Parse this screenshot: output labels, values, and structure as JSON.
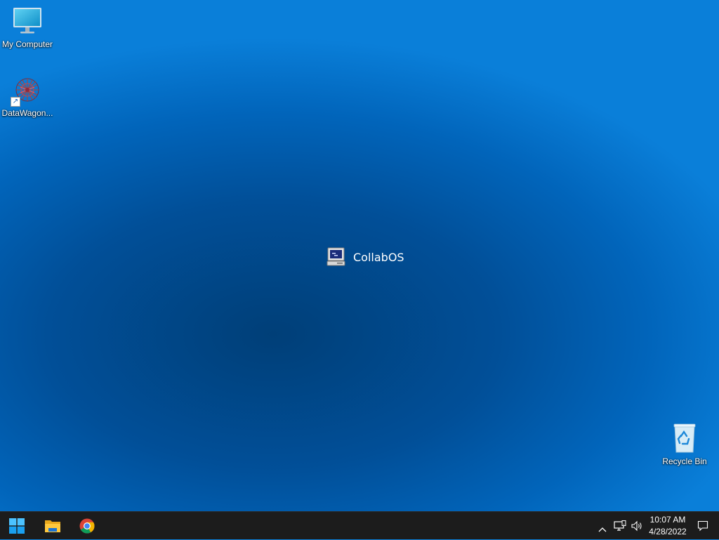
{
  "desktop": {
    "icons": [
      {
        "label": "My Computer",
        "icon": "monitor-icon"
      },
      {
        "label": "DataWagon...",
        "icon": "datawagon-network-icon"
      },
      {
        "label": "Recycle Bin",
        "icon": "recycle-bin-icon"
      }
    ],
    "center_brand": {
      "label": "CollabOS",
      "icon": "retro-computer-icon"
    }
  },
  "taskbar": {
    "pinned": [
      {
        "name": "Start",
        "icon": "windows-start-icon"
      },
      {
        "name": "File Explorer",
        "icon": "folder-icon"
      },
      {
        "name": "Google Chrome",
        "icon": "chrome-icon"
      }
    ],
    "tray": {
      "chevron": "chevron-up-icon",
      "network": "network-icon",
      "volume": "speaker-icon",
      "notifications": "notification-icon"
    },
    "clock": {
      "time": "10:07 AM",
      "date": "4/28/2022"
    }
  },
  "colors": {
    "accent": "#0078d4",
    "taskbar": "#1c1c1c"
  }
}
